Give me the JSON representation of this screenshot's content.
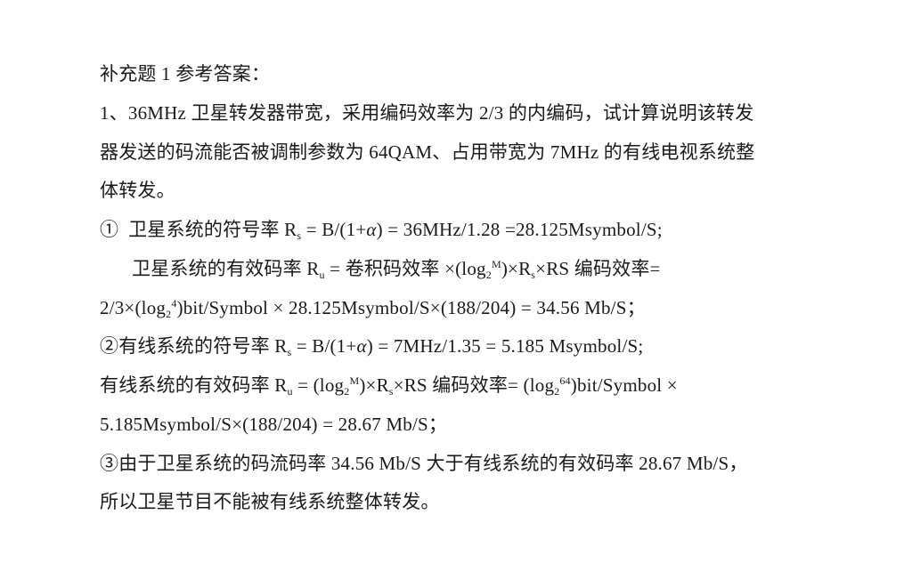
{
  "heading": "补充题 1 参考答案：",
  "question": {
    "line1": "1、36MHz 卫星转发器带宽，采用编码效率为 2/3 的内编码，试计算说明该转发",
    "line2": "器发送的码流能否被调制参数为 64QAM、占用带宽为 7MHz 的有线电视系统整",
    "line3": "体转发。"
  },
  "answer": {
    "s1_marker": "①",
    "s1_label": "卫星系统的符号率 R",
    "sub_s": "s",
    "sub_u": "u",
    "sub_2": "2",
    "sup_M": "M",
    "sup_4": "4",
    "sup_64": "64",
    "alpha": "α",
    "s1_eq_a": " = B/(1+",
    "s1_eq_b": ") = 36MHz/1.28 =28.125Msymbol/S;",
    "s1_eff_label": "卫星系统的有效码率 R",
    "s1_eff_a": " =  卷积码效率  ×(log",
    "s1_eff_b": ")×R",
    "s1_eff_c": "×RS 编码效率=",
    "s1_calc_a": "2/3×(log",
    "s1_calc_b": ")bit/Symbol × 28.125Msymbol/S×(188/204) = 34.56 Mb/S；",
    "s2_label": "②有线系统的符号率 R",
    "s2_eq_a": " = B/(1+",
    "s2_eq_b": ") = 7MHz/1.35 = 5.185 Msymbol/S;",
    "s2_eff_label": "有线系统的有效码率 R",
    "s2_eff_a": " = (log",
    "s2_eff_b": ")×R",
    "s2_eff_c": "×RS 编码效率=    (log",
    "s2_eff_d": ")bit/Symbol ×",
    "s2_calc": "5.185Msymbol/S×(188/204) = 28.67    Mb/S；",
    "s3_line1": "③由于卫星系统的码流码率 34.56 Mb/S 大于有线系统的有效码率 28.67 Mb/S，",
    "s3_line2": "所以卫星节目不能被有线系统整体转发。"
  }
}
